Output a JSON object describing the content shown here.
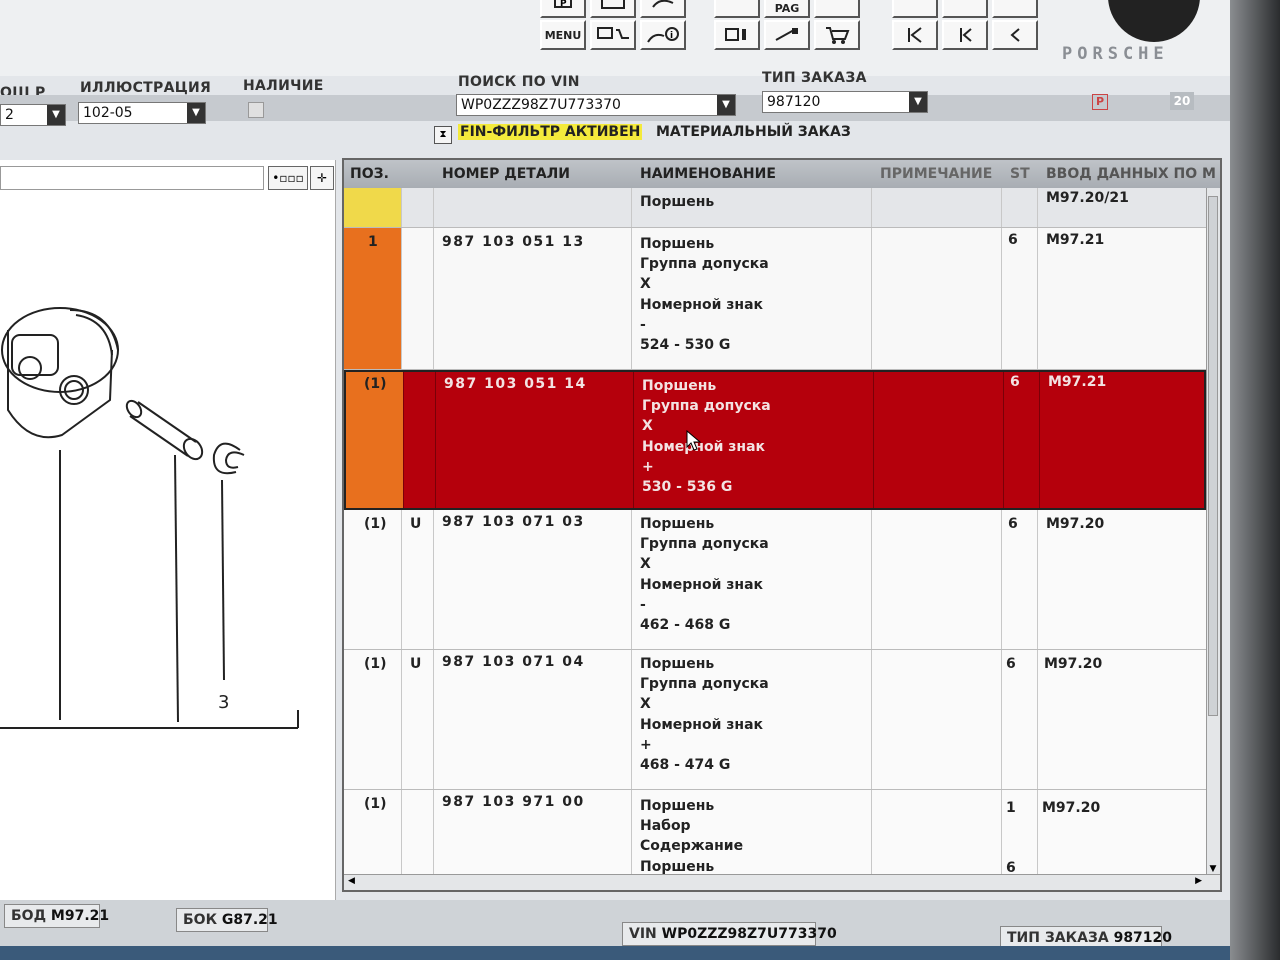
{
  "toolbar": {
    "menu_label": "MENU",
    "pag_label": "PAG",
    "brand": "PORSCHE"
  },
  "search": {
    "col1_label": "ОШ Р",
    "col1_value": "2",
    "illustration_label": "ИЛЛЮСТРАЦИЯ",
    "illustration_value": "102-05",
    "availability_label": "НАЛИЧИЕ",
    "vin_label": "ПОИСК ПО VIN",
    "vin_value": "WP0ZZZ98Z7U773370",
    "order_type_label": "ТИП ЗАКАЗА",
    "order_type_value": "987120",
    "p_badge": "P",
    "count_badge": "20"
  },
  "filter": {
    "fin_label": "FIN-ФИЛЬТР АКТИВЕН",
    "material_label": "МАТЕРИАЛЬНЫЙ ЗАКАЗ"
  },
  "illustration": {
    "callout": "3"
  },
  "table": {
    "headers": [
      "ПОЗ.",
      "НОМЕР ДЕТАЛИ",
      "НАИМЕНОВАНИЕ",
      "ПРИМЕЧАНИЕ",
      "ST",
      "ВВОД ДАННЫХ ПО М"
    ],
    "rows": [
      {
        "pos": "",
        "flag": "",
        "part": "",
        "name": [
          "Поршень"
        ],
        "note": "",
        "st": "",
        "model": "M97.20/21"
      },
      {
        "pos": "1",
        "flag": "",
        "part": "987 103 051 13",
        "name": [
          "Поршень",
          "Группа допуска",
          "X",
          "Номерной знак",
          "-",
          "524 - 530 G"
        ],
        "note": "",
        "st": "6",
        "model": "M97.21"
      },
      {
        "pos": "(1)",
        "flag": "",
        "part": "987 103 051 14",
        "name": [
          "Поршень",
          "Группа допуска",
          "X",
          "Номерной знак",
          "+",
          "530 - 536 G"
        ],
        "note": "",
        "st": "6",
        "model": "M97.21"
      },
      {
        "pos": "(1)",
        "flag": "U",
        "part": "987 103 071 03",
        "name": [
          "Поршень",
          "Группа допуска",
          "X",
          "Номерной знак",
          "-",
          "462 - 468 G"
        ],
        "note": "",
        "st": "6",
        "model": "M97.20"
      },
      {
        "pos": "(1)",
        "flag": "U",
        "part": "987 103 071 04",
        "name": [
          "Поршень",
          "Группа допуска",
          "X",
          "Номерной знак",
          "+",
          "468 - 474 G"
        ],
        "note": "",
        "st": "6",
        "model": "M97.20"
      },
      {
        "pos": "(1)",
        "flag": "",
        "part": "987 103 971 00",
        "name": [
          "Поршень",
          "Набор",
          "Содержание",
          "Поршень"
        ],
        "note": "",
        "st": "1",
        "st2": "6",
        "model": "M97.20"
      }
    ]
  },
  "status": {
    "bod_label": "БОД",
    "bod_value": "M97.21",
    "bok_label": "БОК",
    "bok_value": "G87.21",
    "vin_label": "VIN",
    "vin_value": "WP0ZZZ98Z7U773370",
    "order_label": "ТИП ЗАКАЗА",
    "order_value": "987120"
  },
  "colors": {
    "selected_row": "#b5000c",
    "pos_orange": "#e8701e",
    "pos_yellow": "#f0d94a",
    "fin_highlight": "#f4ea3c"
  }
}
